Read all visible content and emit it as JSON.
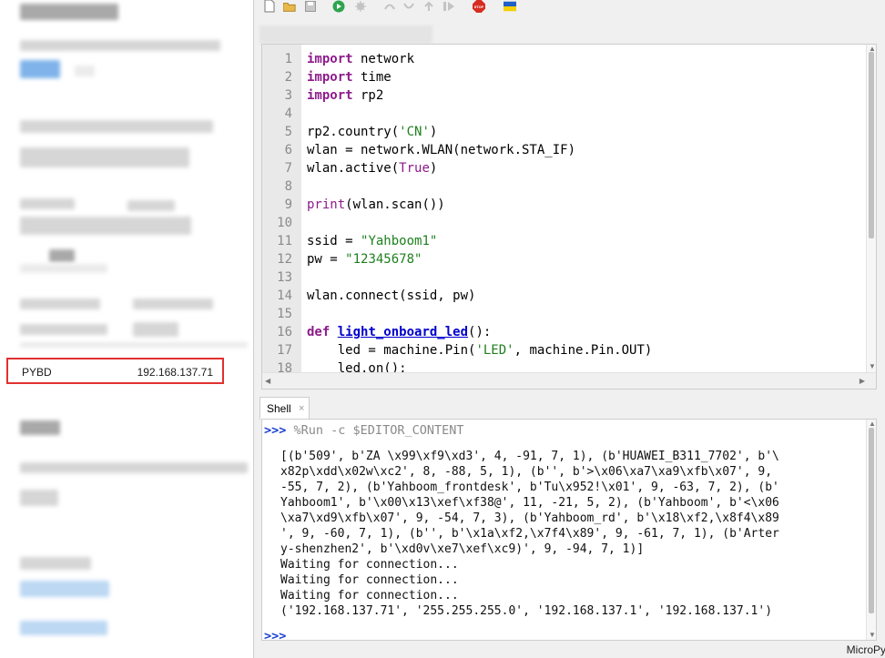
{
  "left_panel": {
    "device_name": "PYBD",
    "device_ip": "192.168.137.71"
  },
  "toolbar": {
    "icons": [
      "new-file-icon",
      "open-file-icon",
      "save-icon",
      "run-icon",
      "debug-icon",
      "step-over-icon",
      "step-into-icon",
      "step-out-icon",
      "resume-icon",
      "stop-icon",
      "ukraine-flag-icon"
    ],
    "stop_label": "STOP"
  },
  "editor": {
    "lines": [
      {
        "n": "1",
        "html": "<span class=\"kw\">import</span> network"
      },
      {
        "n": "2",
        "html": "<span class=\"kw\">import</span> time"
      },
      {
        "n": "3",
        "html": "<span class=\"kw\">import</span> rp2"
      },
      {
        "n": "4",
        "html": ""
      },
      {
        "n": "5",
        "html": "rp2.country(<span class=\"str\">'CN'</span>)"
      },
      {
        "n": "6",
        "html": "wlan = network.WLAN(network.STA_IF)"
      },
      {
        "n": "7",
        "html": "wlan.active(<span class=\"bi\">True</span>)"
      },
      {
        "n": "8",
        "html": ""
      },
      {
        "n": "9",
        "html": "<span class=\"bi\">print</span>(wlan.scan())"
      },
      {
        "n": "10",
        "html": ""
      },
      {
        "n": "11",
        "html": "ssid = <span class=\"str\">\"Yahboom1\"</span>"
      },
      {
        "n": "12",
        "html": "pw = <span class=\"str\">\"12345678\"</span>"
      },
      {
        "n": "13",
        "html": ""
      },
      {
        "n": "14",
        "html": "wlan.connect(ssid, pw)"
      },
      {
        "n": "15",
        "html": ""
      },
      {
        "n": "16",
        "html": "<span class=\"kw\">def</span> <span class=\"fn\">light_onboard_led</span>():"
      },
      {
        "n": "17",
        "html": "    led = machine.Pin(<span class=\"str\">'LED'</span>, machine.Pin.OUT)"
      },
      {
        "n": "18",
        "html": "    led.on();"
      }
    ]
  },
  "shell": {
    "tab_label": "Shell",
    "close_glyph": "×",
    "prompt": ">>>",
    "command": "%Run -c $EDITOR_CONTENT",
    "output": [
      "[(b'509', b'ZA \\x99\\xf9\\xd3', 4, -91, 7, 1), (b'HUAWEI_B311_7702', b'\\",
      "x82p\\xdd\\x02w\\xc2', 8, -88, 5, 1), (b'', b'>\\x06\\xa7\\xa9\\xfb\\x07', 9,",
      "-55, 7, 2), (b'Yahboom_frontdesk', b'Tu\\x952!\\x01', 9, -63, 7, 2), (b'",
      "Yahboom1', b'\\x00\\x13\\xef\\xf38@', 11, -21, 5, 2), (b'Yahboom', b'<\\x06",
      "\\xa7\\xd9\\xfb\\x07', 9, -54, 7, 3), (b'Yahboom_rd', b'\\x18\\xf2,\\x8f4\\x89",
      "', 9, -60, 7, 1), (b'', b'\\x1a\\xf2,\\x7f4\\x89', 9, -61, 7, 1), (b'Arter",
      "y-shenzhen2', b'\\xd0v\\xe7\\xef\\xc9)', 9, -94, 7, 1)]",
      "Waiting for connection...",
      "Waiting for connection...",
      "Waiting for connection...",
      "('192.168.137.71', '255.255.255.0', '192.168.137.1', '192.168.137.1')"
    ]
  },
  "status": {
    "text": "MicroPy"
  }
}
